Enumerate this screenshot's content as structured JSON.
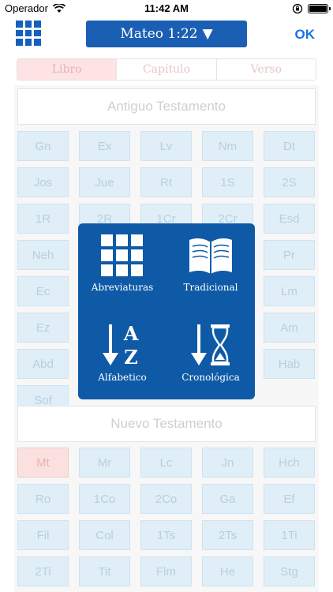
{
  "status_bar": {
    "carrier": "Operador",
    "time": "11:42 AM"
  },
  "nav": {
    "reference_label": "Mateo 1:22",
    "dropdown_glyph": "▼",
    "ok_label": "OK"
  },
  "segments": [
    {
      "label": "Libro",
      "active": true
    },
    {
      "label": "Capítulo",
      "active": false
    },
    {
      "label": "Verso",
      "active": false
    }
  ],
  "old_testament": {
    "title": "Antiguo Testamento",
    "books": [
      "Gn",
      "Ex",
      "Lv",
      "Nm",
      "Dt",
      "Jos",
      "Jue",
      "Rt",
      "1S",
      "2S",
      "1R",
      "2R",
      "1Cr",
      "2Cr",
      "Esd",
      "Neh",
      "",
      "",
      "",
      "Pr",
      "Ec",
      "",
      "",
      "",
      "Lm",
      "Ez",
      "",
      "",
      "",
      "Am",
      "Abd",
      "",
      "",
      "",
      "Hab",
      "Sof"
    ]
  },
  "new_testament": {
    "title": "Nuevo Testamento",
    "books": [
      "Mt",
      "Mr",
      "Lc",
      "Jn",
      "Hch",
      "Ro",
      "1Co",
      "2Co",
      "Ga",
      "Ef",
      "Fil",
      "Col",
      "1Ts",
      "2Ts",
      "1Ti",
      "2Ti",
      "Tit",
      "Flm",
      "He",
      "Stg"
    ],
    "selected": "Mt"
  },
  "popup": {
    "options": [
      {
        "label": "Abreviaturas",
        "icon": "grid-icon"
      },
      {
        "label": "Tradicional",
        "icon": "open-book-icon"
      },
      {
        "label": "Alfabetico",
        "icon": "sort-alpha-icon"
      },
      {
        "label": "Cronológica",
        "icon": "hourglass-sort-icon"
      }
    ]
  },
  "colors": {
    "accent": "#1a5fb4",
    "popup_bg": "#0e5aa7",
    "book_cell": "#dfeef7",
    "selected_cell": "#fbe0e0"
  }
}
